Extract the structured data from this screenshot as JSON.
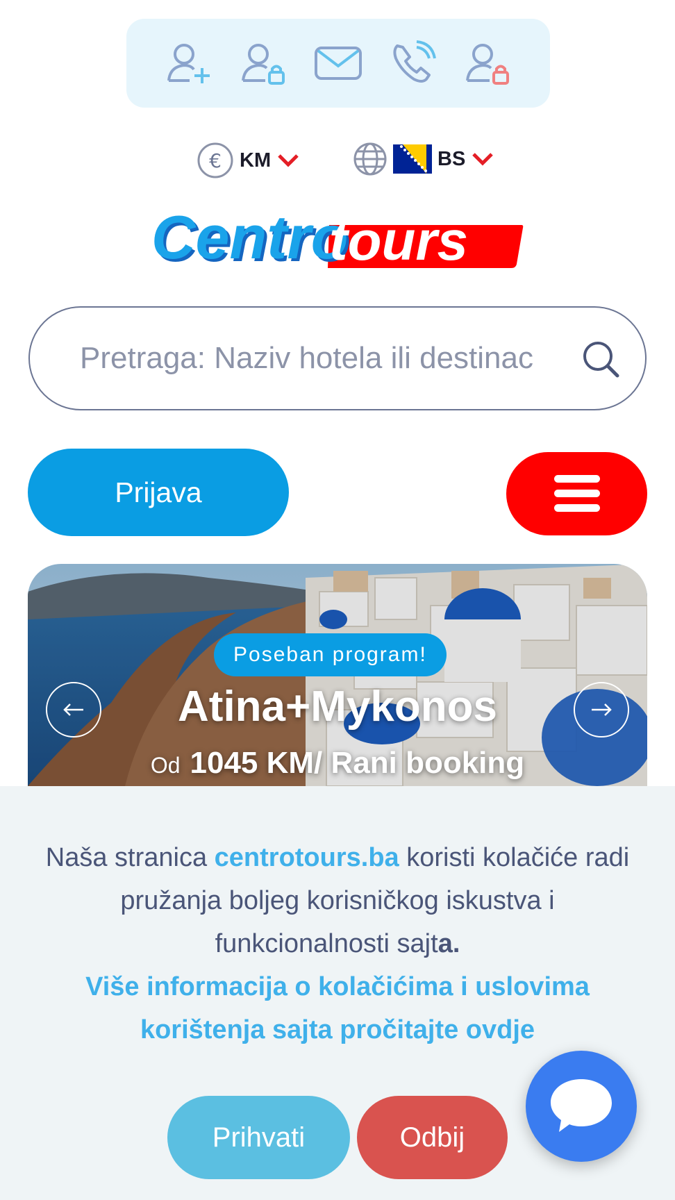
{
  "topbar": {
    "icons": [
      "user-add-icon",
      "user-lock-icon",
      "mail-icon",
      "phone-icon",
      "user-lock-red-icon"
    ]
  },
  "currency": {
    "label": "KM",
    "icon": "euro-icon"
  },
  "language": {
    "label": "BS",
    "icon": "globe-icon",
    "flag": "bosnia-flag"
  },
  "logo": {
    "part1": "Centro",
    "part2": "tours"
  },
  "search": {
    "placeholder": "Pretraga: Naziv hotela ili destinac"
  },
  "login_label": "Prijava",
  "hero": {
    "badge": "Poseban program!",
    "title": "Atina+Mykonos",
    "price_prefix": "Od",
    "price": "1045 KM/ Rani booking"
  },
  "cookie": {
    "text_before": "Naša stranica ",
    "site": "centrotours.ba",
    "text_after": " koristi kolačiće radi pružanja boljeg korisničkog iskustva i funkcionalnosti sajt",
    "text_end": "a.",
    "more_link": "Više informacija o kolačićima i uslovima korištenja sajta pročitajte ovdje",
    "accept": "Prihvati",
    "deny": "Odbij"
  },
  "colors": {
    "brand_blue": "#0a9de3",
    "brand_red": "#ff0000",
    "link": "#3fb0ea",
    "chat": "#3a7cf0"
  }
}
